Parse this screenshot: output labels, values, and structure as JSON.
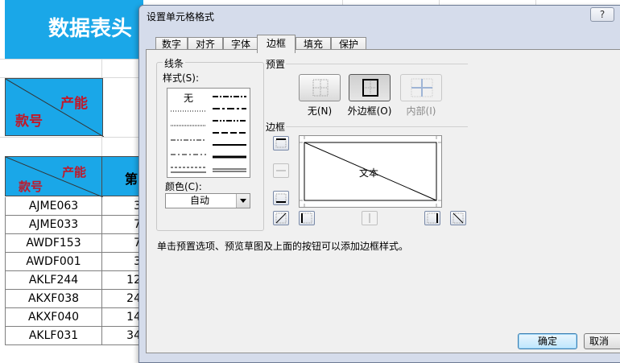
{
  "sheet": {
    "title": "数据表头",
    "header_top_label": "产能",
    "header_bottom_label": "款号",
    "col2_header": "第",
    "rows": [
      {
        "code": "AJME063",
        "value": "3"
      },
      {
        "code": "AJME033",
        "value": "7"
      },
      {
        "code": "AWDF153",
        "value": "7"
      },
      {
        "code": "AWDF001",
        "value": "3"
      },
      {
        "code": "AKLF244",
        "value": "12"
      },
      {
        "code": "AKXF038",
        "value": "24"
      },
      {
        "code": "AKXF040",
        "value": "14"
      },
      {
        "code": "AKLF031",
        "value": "34"
      }
    ],
    "accent_color": "#1aa7e8",
    "header_text_color": "#c0182a"
  },
  "dialog": {
    "title": "设置单元格格式",
    "help_label": "?",
    "tabs": [
      "数字",
      "对齐",
      "字体",
      "边框",
      "填充",
      "保护"
    ],
    "active_tab": "边框",
    "line_group": {
      "label": "线条",
      "style_label": "样式(S):",
      "none_label": "无",
      "color_label": "颜色(C):",
      "color_value": "自动"
    },
    "presets": {
      "label": "预置",
      "none": "无(N)",
      "outline": "外边框(O)",
      "inside": "内部(I)"
    },
    "border": {
      "label": "边框",
      "preview_text": "文本"
    },
    "hint": "单击预置选项、预览草图及上面的按钮可以添加边框样式。",
    "ok_label": "确定",
    "cancel_label": "取消"
  }
}
